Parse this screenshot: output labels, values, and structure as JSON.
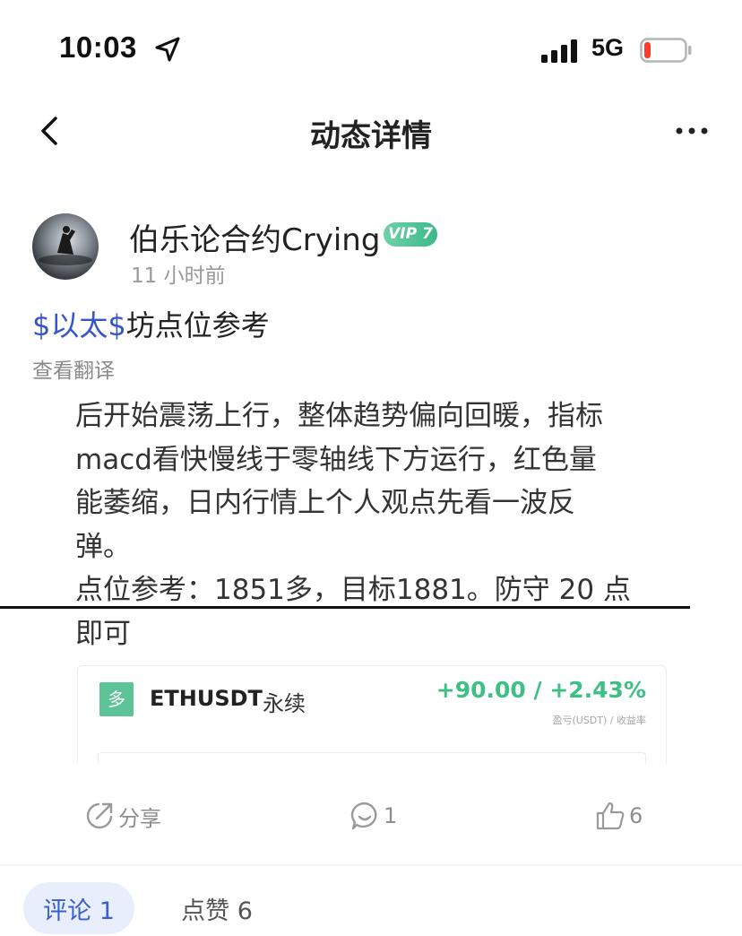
{
  "status_bar": {
    "time": "10:03",
    "network": "5G",
    "icons": [
      "location-arrow-icon",
      "cell-signal-icon",
      "battery-low-icon"
    ]
  },
  "nav": {
    "title": "动态详情",
    "icons": [
      "chevron-left-icon",
      "more-horizontal-icon"
    ]
  },
  "author": {
    "name": "伯乐论合约Crying",
    "vip": "VIP 7",
    "time_ago": "11 小时前"
  },
  "post": {
    "title_tag": "$以太$",
    "title_rest": "坊点位参考",
    "translate": "查看翻译",
    "body_lines": [
      "后开始震荡上行，整体趋势偏向回暖，指标",
      "macd看快慢线于零轴线下方运行，红色量",
      "能萎缩，日内行情上个人观点先看一波反",
      "弹。",
      "点位参考：1851多，目标1881。防守 20 点",
      "即可"
    ]
  },
  "trade_card": {
    "direction": "多",
    "symbol": "ETHUSDT",
    "contract": "永续",
    "pnl": "+90.00 / +2.43%",
    "pnl_label": "盈亏(USDT) / 收益率",
    "colors": {
      "profit": "#3fbf86",
      "badge": "#5cc396"
    }
  },
  "actions": {
    "share_label": "分享",
    "comment_count": "1",
    "like_count": "6"
  },
  "tabs": [
    {
      "label": "评论 1",
      "active": true
    },
    {
      "label": "点赞 6",
      "active": false
    }
  ],
  "colors": {
    "accent": "#3a5fcd",
    "tag_link": "#3456c8",
    "vip_badge": "#3cb988"
  }
}
